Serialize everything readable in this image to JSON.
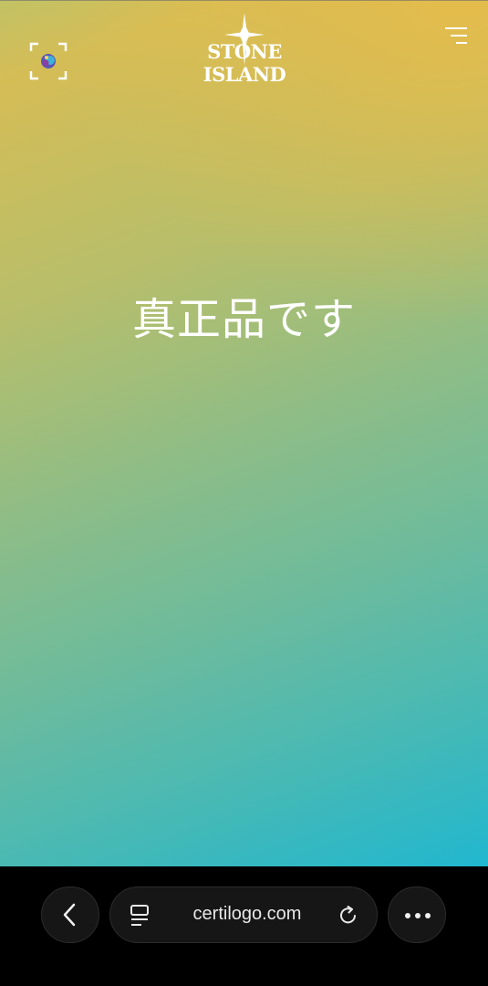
{
  "header": {
    "brand": "STONE ISLAND",
    "scan_icon": "scan-target-icon",
    "menu_icon": "hamburger-menu-icon"
  },
  "main": {
    "headline": "真正品です"
  },
  "browser_bar": {
    "url": "certilogo.com",
    "back_icon": "chevron-left-icon",
    "tabs_icon": "page-tabs-icon",
    "reload_icon": "reload-icon",
    "more_icon": "more-dots-icon"
  },
  "colors": {
    "gradient_top": "#d5bd56",
    "gradient_bottom": "#21b7cf",
    "text": "#ffffff",
    "bar_bg": "#000000"
  }
}
